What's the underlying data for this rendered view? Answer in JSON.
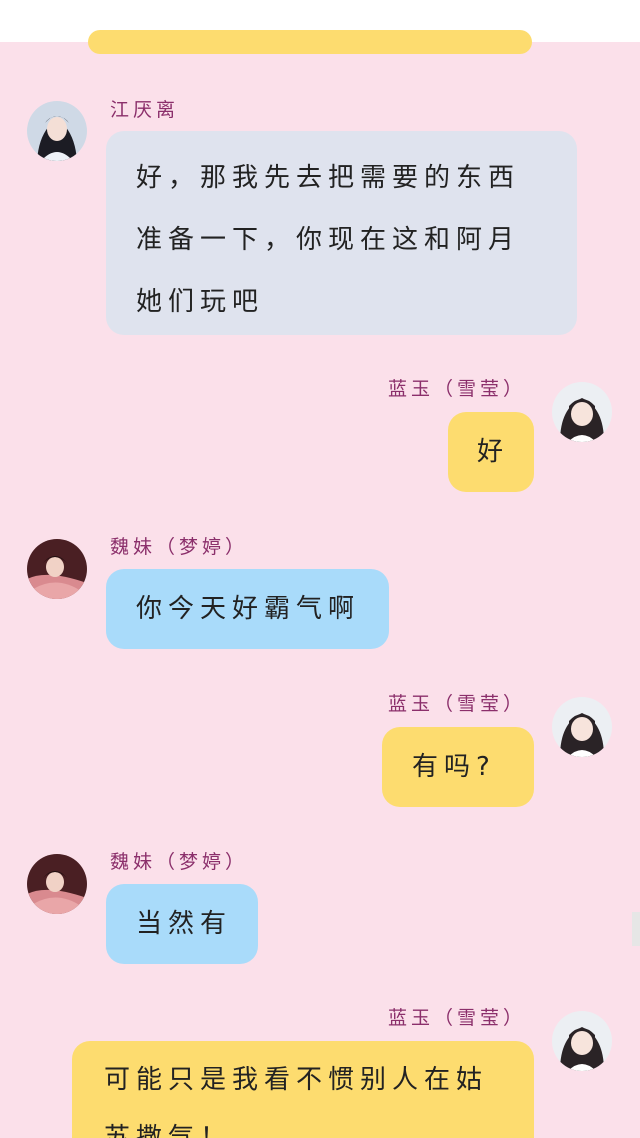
{
  "messages": [
    {
      "sender": "江厌离",
      "lines": [
        "好，那我先去把需要的东西",
        "准备一下，你现在这和阿月",
        "她们玩吧"
      ],
      "avatar_icon": "avatar-jiang-yanli-icon"
    },
    {
      "sender": "蓝玉（雪莹）",
      "text": "好",
      "avatar_icon": "avatar-lan-yu-icon"
    },
    {
      "sender": "魏妹（梦婷）",
      "text": "你今天好霸气啊",
      "avatar_icon": "avatar-wei-mei-icon"
    },
    {
      "sender": "蓝玉（雪莹）",
      "text": "有吗?",
      "avatar_icon": "avatar-lan-yu-icon"
    },
    {
      "sender": "魏妹（梦婷）",
      "text": "当然有",
      "avatar_icon": "avatar-wei-mei-icon"
    },
    {
      "sender": "蓝玉（雪莹）",
      "lines": [
        "可能只是我看不惯别人在姑",
        "苏撒气！"
      ],
      "avatar_icon": "avatar-lan-yu-icon"
    }
  ],
  "colors": {
    "background": "#fbe0ea",
    "gray_bubble": "#dfe3ee",
    "yellow_bubble": "#fddc6f",
    "blue_bubble": "#a9dbfa",
    "name_text": "#8b2f6b"
  }
}
